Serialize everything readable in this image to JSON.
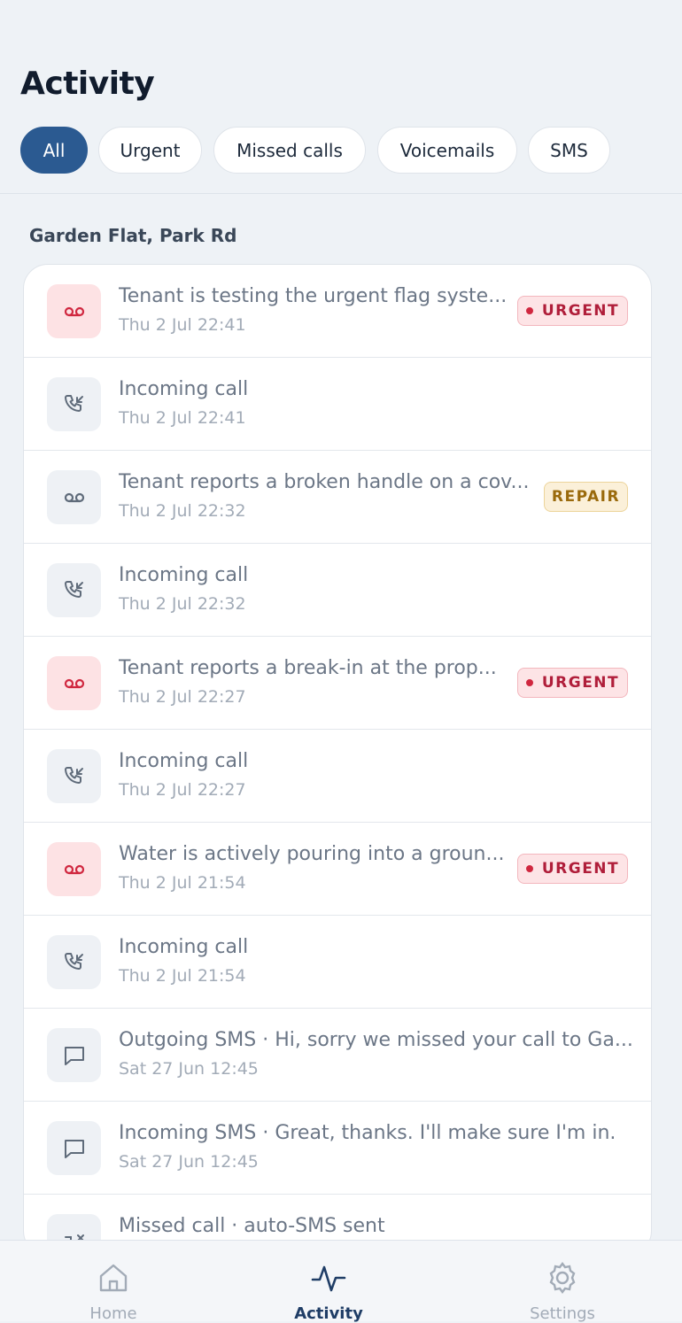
{
  "header": {
    "title": "Activity"
  },
  "filters": [
    {
      "label": "All",
      "active": true
    },
    {
      "label": "Urgent",
      "active": false
    },
    {
      "label": "Missed calls",
      "active": false
    },
    {
      "label": "Voicemails",
      "active": false
    },
    {
      "label": "SMS",
      "active": false
    }
  ],
  "group": {
    "label": "Garden Flat, Park Rd"
  },
  "activities": [
    {
      "icon": "voicemail-icon",
      "title": "Tenant is testing the urgent flag syste...",
      "time": "Thu 2 Jul 22:41",
      "badge": "URGENT"
    },
    {
      "icon": "incoming-call-icon",
      "title": "Incoming call",
      "time": "Thu 2 Jul 22:41"
    },
    {
      "icon": "voicemail-icon",
      "title": "Tenant reports a broken handle on a cov...",
      "time": "Thu 2 Jul 22:32",
      "badge": "REPAIR"
    },
    {
      "icon": "incoming-call-icon",
      "title": "Incoming call",
      "time": "Thu 2 Jul 22:32"
    },
    {
      "icon": "voicemail-icon",
      "title": "Tenant reports a break-in at the prop...",
      "time": "Thu 2 Jul 22:27",
      "badge": "URGENT"
    },
    {
      "icon": "incoming-call-icon",
      "title": "Incoming call",
      "time": "Thu 2 Jul 22:27"
    },
    {
      "icon": "voicemail-icon",
      "title": "Water is actively pouring into a groun...",
      "time": "Thu 2 Jul 21:54",
      "badge": "URGENT"
    },
    {
      "icon": "incoming-call-icon",
      "title": "Incoming call",
      "time": "Thu 2 Jul 21:54"
    },
    {
      "icon": "message-icon",
      "title": "Outgoing SMS · Hi, sorry we missed your call to Ga...",
      "time": "Sat 27 Jun 12:45"
    },
    {
      "icon": "message-icon",
      "title": "Incoming SMS · Great, thanks. I'll make sure I'm in.",
      "time": "Sat 27 Jun 12:45"
    },
    {
      "icon": "missed-call-icon",
      "title": "Missed call · auto-SMS sent",
      "time": ""
    }
  ],
  "nav": [
    {
      "label": "Home",
      "icon": "home-icon",
      "active": false
    },
    {
      "label": "Activity",
      "icon": "activity-icon",
      "active": true
    },
    {
      "label": "Settings",
      "icon": "gear-icon",
      "active": false
    }
  ],
  "colors": {
    "accent": "#2b5a91",
    "urgent": "#d0273f",
    "repair": "#9a6a0c"
  }
}
